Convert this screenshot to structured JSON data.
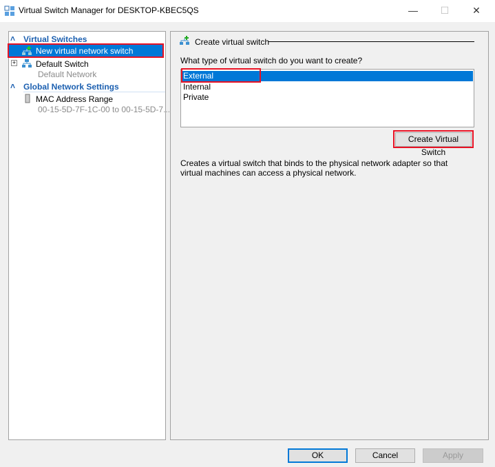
{
  "window": {
    "title": "Virtual Switch Manager for DESKTOP-KBEC5QS",
    "minimize": "—",
    "maximize": "☐",
    "close": "✕"
  },
  "sidebar": {
    "virtual_switches": "Virtual Switches",
    "new_switch": "New virtual network switch",
    "default_switch": "Default Switch",
    "default_network": "Default Network",
    "global": "Global Network Settings",
    "mac": "MAC Address Range",
    "mac_value": "00-15-5D-7F-1C-00 to 00-15-5D-7..."
  },
  "main": {
    "heading": "Create virtual switch",
    "question": "What type of virtual switch do you want to create?",
    "options": [
      "External",
      "Internal",
      "Private"
    ],
    "selected": "External",
    "create_button": "Create Virtual Switch",
    "description": "Creates a virtual switch that binds to the physical network adapter so that virtual machines can access a physical network."
  },
  "footer": {
    "ok": "OK",
    "cancel": "Cancel",
    "apply": "Apply"
  },
  "colors": {
    "selection": "#0078d7",
    "highlight": "#e81123"
  }
}
